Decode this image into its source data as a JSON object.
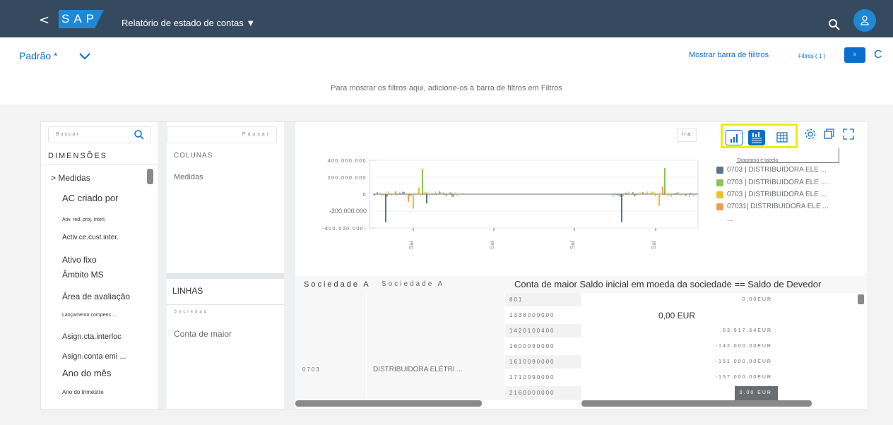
{
  "shell": {
    "back": "<",
    "logo": "SAP",
    "title": "Relatório de estado de contas ▼"
  },
  "header": {
    "variant": "Padrão *",
    "show_filter_bar": "Mostrar barra de fiiltros",
    "filters": "Filtros ( 1 )",
    "go": "Ir",
    "refresh": "C",
    "hint": "Para mostrar os filtros aqui, adicione-os à barra de filtros em Filtros"
  },
  "dimensions": {
    "search_placeholder": "Buscar",
    "title": "DIMENSÕES",
    "items": [
      "> Medidas",
      "AC criado por",
      "Ativ. red. proj. interl.",
      "Activ.ce.cust.inter.",
      "Ativo fixo",
      "Âmbito MS",
      "Área de avaliação",
      "Lançamento compens ...",
      "Asign.cta.interloc",
      "Asign.conta emi ...",
      "Ano do mês",
      "Ano do trimestre"
    ]
  },
  "columns": {
    "pause": "Pausar",
    "title": "COLUNAS",
    "items": [
      "Medidas"
    ],
    "rows_title": "LINHAS",
    "rows_sub": "Sociedad",
    "rows_items": [
      "Conta de maior"
    ]
  },
  "chart": {
    "ir": "Ira",
    "tooltip": "Diagrama e tabela",
    "legend": [
      {
        "text": "0703  |  DISTRIBUIDORA ELE ...",
        "color": "#5b738b"
      },
      {
        "text": "0703  |  DISTRIBUIDORA ELE ...",
        "color": "#8fc15a"
      },
      {
        "text": "0703  |  DISTRIBUIDORA ELE ...",
        "color": "#e9c22c"
      },
      {
        "text": "07031|  DISTRIBUIDORA ELE ...",
        "color": "#f29b58"
      }
    ],
    "legend_more": "...",
    "x_tick": "Sal"
  },
  "chart_data": {
    "type": "bar",
    "yticks": [
      "400.000.000",
      "200.000.000",
      "0",
      "-200,000.000",
      "-400.000.000-"
    ],
    "ylim": [
      -400000000,
      400000000
    ],
    "categories": [
      "Sal",
      "Sal",
      "Sal",
      "Sal"
    ],
    "series": [
      {
        "name": "0703 | DISTRIBUIDORA ELE ...",
        "color": "#5b738b"
      },
      {
        "name": "0703 | DISTRIBUIDORA ELE ...",
        "color": "#8fc15a"
      },
      {
        "name": "0703 | DISTRIBUIDORA ELE ...",
        "color": "#e9c22c"
      },
      {
        "name": "07031| DISTRIBUIDORA ELE ...",
        "color": "#f29b58"
      }
    ],
    "notable_values": [
      {
        "series": 1,
        "value": 300000000
      },
      {
        "series": 0,
        "value": -330000000
      },
      {
        "series": 1,
        "value": 310000000
      },
      {
        "series": 0,
        "value": -330000000
      },
      {
        "series": 2,
        "value": 80000000
      },
      {
        "series": 2,
        "value": -170000000
      }
    ]
  },
  "table": {
    "headers": {
      "soc1": "Sociedade A",
      "soc2": "Sociedade A",
      "main": "Conta de maior Saldo inicial em moeda da sociedade == Saldo de Devedor"
    },
    "company_code": "0703",
    "company_name": "DISTRIBUIDORA ELÉTRI ...",
    "rows": [
      {
        "account": "801",
        "value": "0,00EUR"
      },
      {
        "account": "1338000000",
        "value": "0,00  EUR"
      },
      {
        "account": "1420100400",
        "value": "63.917,64EUR"
      },
      {
        "account": "1600090000",
        "value": "-142.000,00EUR"
      },
      {
        "account": "1610090000",
        "value": "-151.000,00EUR"
      },
      {
        "account": "1710090000",
        "value": "-157.000,00EUR"
      },
      {
        "account": "2160000000",
        "value": "0.00 EUR"
      }
    ]
  }
}
